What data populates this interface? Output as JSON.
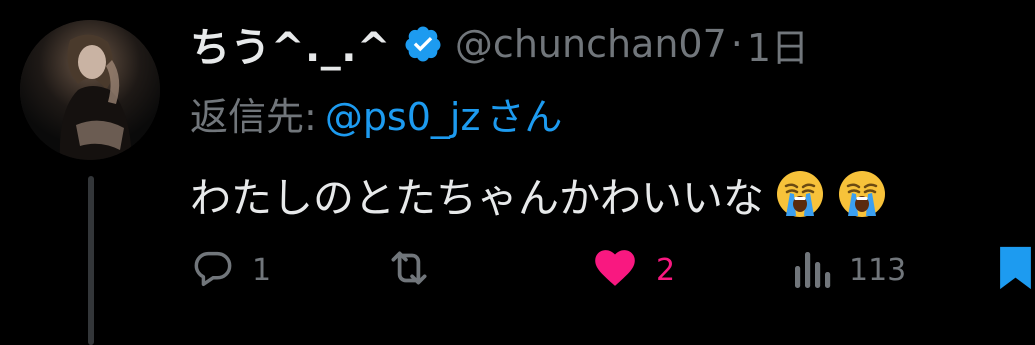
{
  "tweet": {
    "display_name": "ちう^._.^",
    "handle": "@chunchan07",
    "separator": "·",
    "time": "1日",
    "reply_prefix": "返信先:",
    "reply_user": "@ps0_jz",
    "reply_suffix": "さん",
    "text": "わたしのとたちゃんかわいいな",
    "emojis": [
      "loudly-crying-face",
      "loudly-crying-face"
    ]
  },
  "actions": {
    "reply_count": "1",
    "retweet_count": "",
    "like_count": "2",
    "views_count": "113"
  },
  "colors": {
    "background": "#000000",
    "primary_text": "#e7e9ea",
    "secondary_text": "#71767b",
    "link": "#1d9bf0",
    "like": "#f91880",
    "bookmark": "#1d9bf0"
  }
}
